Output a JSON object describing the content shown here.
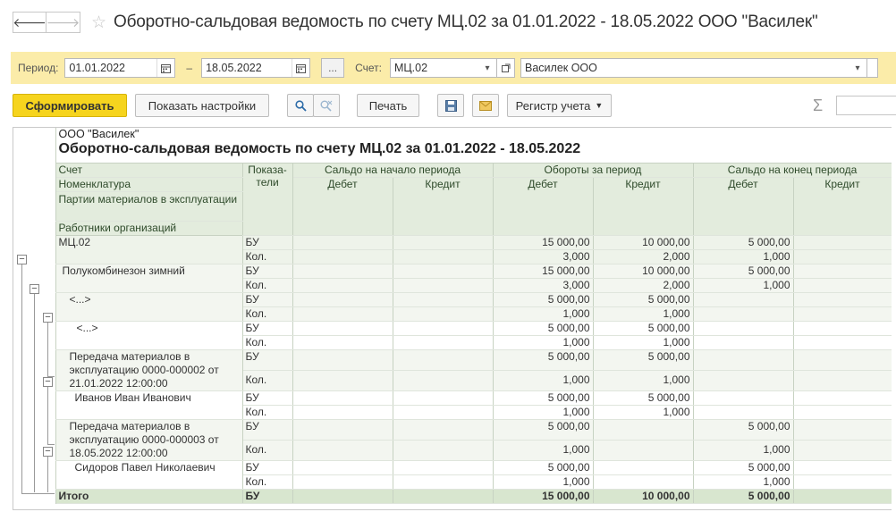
{
  "window": {
    "title": "Оборотно-сальдовая ведомость по счету МЦ.02 за 01.01.2022 - 18.05.2022 ООО \"Василек\"",
    "back_glyph": "🡐",
    "fwd_glyph": "🡒",
    "star_glyph": "☆"
  },
  "period": {
    "label": "Период:",
    "from": "01.01.2022",
    "dash": "–",
    "to": "18.05.2022",
    "more_label": "...",
    "account_label": "Счет:",
    "account": "МЦ.02",
    "org": "Василек ООО"
  },
  "toolbar": {
    "generate": "Сформировать",
    "settings": "Показать настройки",
    "print": "Печать",
    "register": "Регистр учета",
    "sigma": "Σ"
  },
  "report": {
    "org": "ООО \"Василек\"",
    "title": "Оборотно-сальдовая ведомость по счету МЦ.02 за 01.01.2022 - 18.05.2022",
    "header": {
      "row_labels": [
        "Счет",
        "Номенклатура",
        "Партии материалов в эксплуатации",
        "Работники организаций"
      ],
      "indicators": "Показа-тели",
      "opening": "Сальдо на начало периода",
      "turnover": "Обороты за период",
      "closing": "Сальдо на конец периода",
      "debit": "Дебет",
      "credit": "Кредит"
    },
    "rows": [
      {
        "name": "МЦ.02",
        "level": "grp1",
        "bu": [
          "",
          "",
          "15 000,00",
          "10 000,00",
          "5 000,00",
          ""
        ],
        "kol": [
          "",
          "",
          "3,000",
          "2,000",
          "1,000",
          ""
        ]
      },
      {
        "name": "Полукомбинезон зимний",
        "level": "grp2",
        "bu": [
          "",
          "",
          "15 000,00",
          "10 000,00",
          "5 000,00",
          ""
        ],
        "kol": [
          "",
          "",
          "3,000",
          "2,000",
          "1,000",
          ""
        ]
      },
      {
        "name": "<...>",
        "level": "grp2",
        "bu": [
          "",
          "",
          "5 000,00",
          "5 000,00",
          "",
          ""
        ],
        "kol": [
          "",
          "",
          "1,000",
          "1,000",
          "",
          ""
        ]
      },
      {
        "name": "<...>",
        "level": "plain",
        "bu": [
          "",
          "",
          "5 000,00",
          "5 000,00",
          "",
          ""
        ],
        "kol": [
          "",
          "",
          "1,000",
          "1,000",
          "",
          ""
        ]
      },
      {
        "name": "Передача материалов в эксплуатацию 0000-000002 от 21.01.2022 12:00:00",
        "level": "grp2",
        "bu": [
          "",
          "",
          "5 000,00",
          "5 000,00",
          "",
          ""
        ],
        "kol": [
          "",
          "",
          "1,000",
          "1,000",
          "",
          ""
        ]
      },
      {
        "name": "Иванов Иван Иванович",
        "level": "plain",
        "bu": [
          "",
          "",
          "5 000,00",
          "5 000,00",
          "",
          ""
        ],
        "kol": [
          "",
          "",
          "1,000",
          "1,000",
          "",
          ""
        ]
      },
      {
        "name": "Передача материалов в эксплуатацию 0000-000003 от 18.05.2022 12:00:00",
        "level": "grp2",
        "bu": [
          "",
          "",
          "5 000,00",
          "",
          "5 000,00",
          ""
        ],
        "kol": [
          "",
          "",
          "1,000",
          "",
          "1,000",
          ""
        ]
      },
      {
        "name": "Сидоров Павел Николаевич",
        "level": "plain",
        "bu": [
          "",
          "",
          "5 000,00",
          "",
          "5 000,00",
          ""
        ],
        "kol": [
          "",
          "",
          "1,000",
          "",
          "1,000",
          ""
        ]
      }
    ],
    "bu_label": "БУ",
    "kol_label": "Кол.",
    "total": {
      "name": "Итого",
      "ind": "БУ",
      "values": [
        "",
        "",
        "15 000,00",
        "10 000,00",
        "5 000,00",
        ""
      ]
    }
  }
}
